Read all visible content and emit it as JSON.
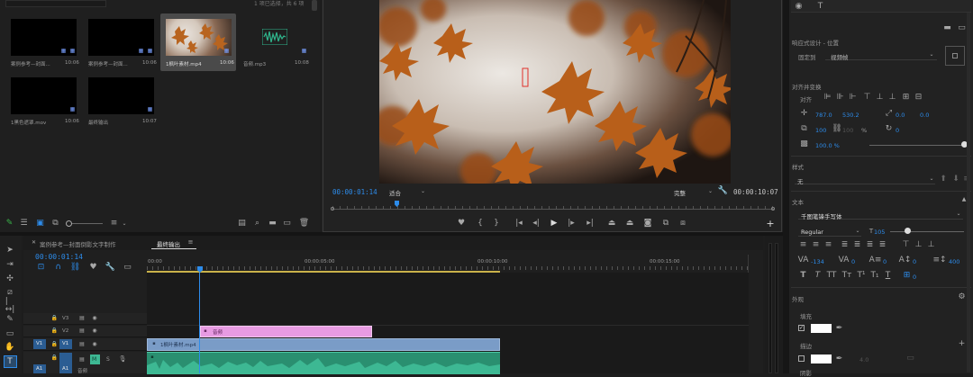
{
  "project": {
    "search_placeholder": "",
    "selection_status": "1 项已选择，共 6 项",
    "items": [
      {
        "name": "案例参考—封面...",
        "duration": "10:06",
        "kind": "sequence"
      },
      {
        "name": "案例参考—封面...",
        "duration": "10:06",
        "kind": "sequence"
      },
      {
        "name": "1枫叶素材.mp4",
        "duration": "10:06",
        "kind": "video"
      },
      {
        "name": "音频.mp3",
        "duration": "10:08",
        "kind": "audio"
      },
      {
        "name": "1黑色遮罩.mov",
        "duration": "10:06",
        "kind": "sequence"
      },
      {
        "name": "最终输出",
        "duration": "10:07",
        "kind": "sequence"
      }
    ]
  },
  "monitor": {
    "timecode_current": "00:00:01:14",
    "fit": "适合",
    "quality": "完整",
    "timecode_duration": "00:00:10:07"
  },
  "timeline": {
    "tab_inactive": "案例参考—封面倒影文字制作",
    "tab_active": "最终输出",
    "timecode": "00:00:01:14",
    "ruler": [
      "00:00",
      "00:00:05:00",
      "00:00:10:00",
      "00:00:15:00"
    ],
    "tracks": {
      "v3": "V3",
      "v2": "V2",
      "v1": "V1",
      "v1_target": "V1",
      "a1": "A1",
      "a1_target": "A1",
      "a1_m": "M",
      "a1_s": "S"
    },
    "clips": {
      "title": "音频",
      "video": "1枫叶素材.mp4",
      "audio": "音频"
    }
  },
  "essential_graphics": {
    "responsive_label": "响应式设计 - 位置",
    "pin_label": "固定到",
    "pin_value": "视频帧",
    "align_label": "对齐并变换",
    "align_short": "对齐",
    "pos_x": "787.0",
    "pos_y": "530.2",
    "anchor_x": "0.0",
    "anchor_y": "0.0",
    "scale": "100",
    "scale_h": "100",
    "scale_unit": "%",
    "rotation": "0",
    "opacity": "100.0 %",
    "style_header": "样式",
    "style_value": "无",
    "text_header": "文本",
    "font_family": "千图笔锋手写体",
    "font_style": "Regular",
    "font_size": "105",
    "tracking": "-134",
    "kerning": "0",
    "leading": "0",
    "baseline": "0",
    "tsume": "0",
    "line_spacing": "400",
    "appearance_header": "外观",
    "fill_label": "填充",
    "stroke_label": "描边",
    "shadow_label": "阴影",
    "stroke_width": "4.0"
  },
  "colors": {
    "accent": "#2d8ceb",
    "title_clip": "#e79be2",
    "video_clip": "#7a9cc7",
    "audio_clip": "#3db893",
    "playhead": "#2d8ceb",
    "work_area": "#c9b24a"
  }
}
